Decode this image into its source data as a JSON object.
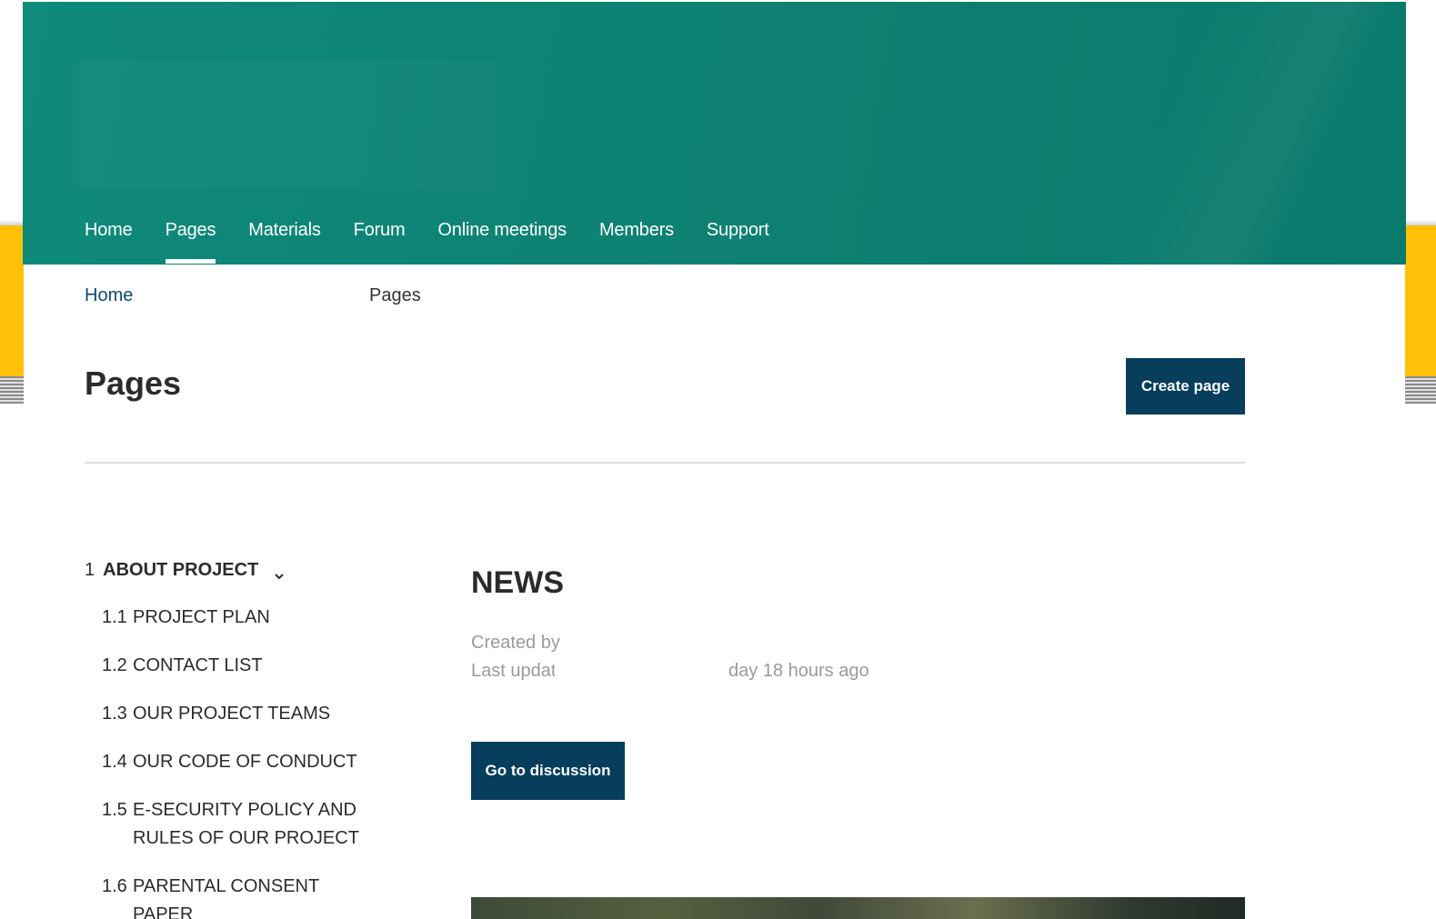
{
  "nav": {
    "items": [
      {
        "label": "Home"
      },
      {
        "label": "Pages",
        "active": true
      },
      {
        "label": "Materials"
      },
      {
        "label": "Forum"
      },
      {
        "label": "Online meetings"
      },
      {
        "label": "Members"
      },
      {
        "label": "Support"
      }
    ]
  },
  "breadcrumb": {
    "home": "Home",
    "current": "Pages"
  },
  "page": {
    "title": "Pages",
    "create_button": "Create page"
  },
  "tree": {
    "root": {
      "number": "1",
      "label": "ABOUT PROJECT",
      "expanded": true,
      "icon": "chevron-down-icon"
    },
    "children": [
      {
        "number": "1.1",
        "label": "PROJECT PLAN"
      },
      {
        "number": "1.2",
        "label": "CONTACT LIST"
      },
      {
        "number": "1.3",
        "label": "OUR PROJECT TEAMS"
      },
      {
        "number": "1.4",
        "label": "OUR CODE OF CONDUCT"
      },
      {
        "number": "1.5",
        "label": "E-SECURITY POLICY AND RULES OF OUR PROJECT"
      },
      {
        "number": "1.6",
        "label": "PARENTAL CONSENT PAPER"
      }
    ]
  },
  "article": {
    "title": "NEWS",
    "created_by": "Created by",
    "last_updated_prefix": "Last update",
    "last_updated_suffix": "day 18 hours ago",
    "discussion_button": "Go to discussion"
  },
  "colors": {
    "header": "#0e8273",
    "button": "#063e5c",
    "link": "#0d4a75",
    "side_accent": "#ffc107"
  }
}
